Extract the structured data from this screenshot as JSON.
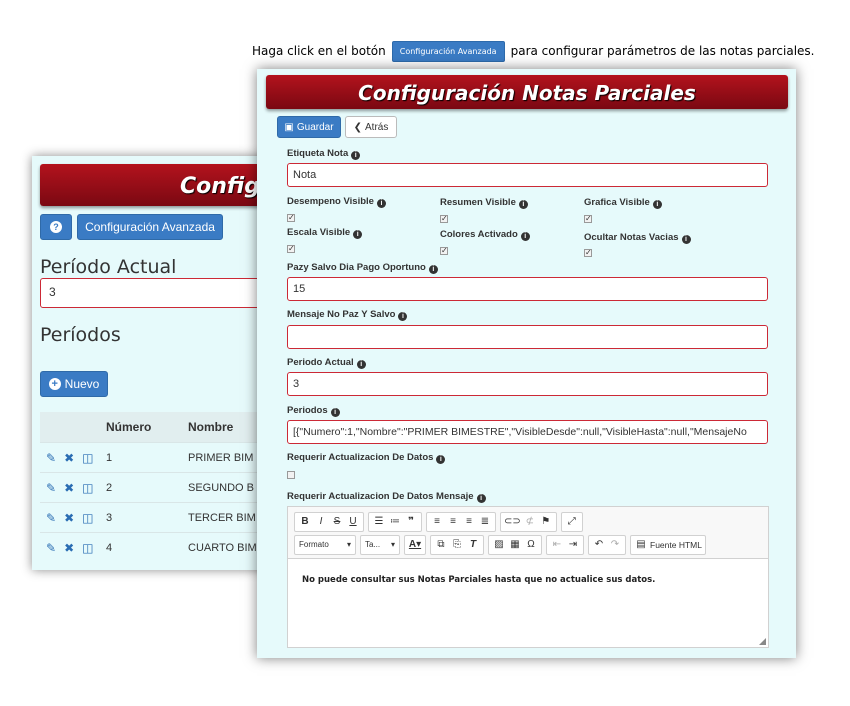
{
  "caption": {
    "before": "Haga click en el botón",
    "button": "Configuración Avanzada",
    "after": "para configurar parámetros de las notas parciales."
  },
  "back": {
    "banner": "Configu",
    "help_icon": "?",
    "advanced_button": "Configuración Avanzada",
    "periodo_actual_title": "Período Actual",
    "periodo_actual_value": "3",
    "periodos_title": "Períodos",
    "new_button": "Nuevo",
    "table": {
      "headers": [
        "",
        "Número",
        "Nombre"
      ],
      "rows": [
        {
          "numero": "1",
          "nombre": "PRIMER BIM"
        },
        {
          "numero": "2",
          "nombre": "SEGUNDO B"
        },
        {
          "numero": "3",
          "nombre": "TERCER BIM"
        },
        {
          "numero": "4",
          "nombre": "CUARTO BIM"
        }
      ]
    }
  },
  "front": {
    "banner": "Configuración Notas Parciales",
    "save_button": "Guardar",
    "back_button": "Atrás",
    "etiqueta_label": "Etiqueta Nota",
    "etiqueta_value": "Nota",
    "checks": {
      "desempeno": "Desempeno Visible",
      "resumen": "Resumen Visible",
      "grafica": "Grafica Visible",
      "escala": "Escala Visible",
      "colores": "Colores Activado",
      "ocultar": "Ocultar Notas Vacias"
    },
    "pazysalvo_label": "Pazy Salvo Dia Pago Oportuno",
    "pazysalvo_value": "15",
    "mensaje_label": "Mensaje No Paz Y Salvo",
    "mensaje_value": "",
    "periodo_label": "Periodo Actual",
    "periodo_value": "3",
    "periodos_label": "Periodos",
    "periodos_value": "[{\"Numero\":1,\"Nombre\":\"PRIMER BIMESTRE\",\"VisibleDesde\":null,\"VisibleHasta\":null,\"MensajeNo",
    "requerir_label": "Requerir Actualizacion De Datos",
    "requerir_msg_label": "Requerir Actualizacion De Datos Mensaje",
    "editor": {
      "format_combo": "Formato",
      "size_combo": "Ta...",
      "source_button": "Fuente HTML",
      "body": "No puede consultar sus Notas Parciales hasta que no actualice sus datos."
    }
  }
}
